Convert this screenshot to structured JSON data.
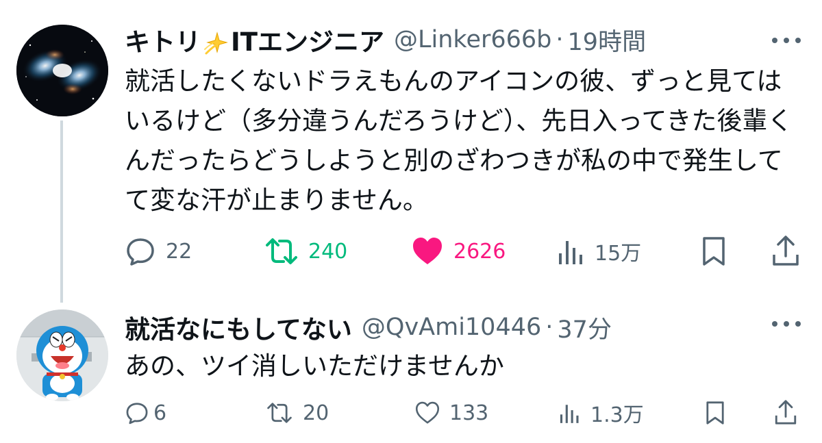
{
  "tweets": [
    {
      "display_name_prefix": "キトリ",
      "display_name_suffix": "ITエンジニア",
      "handle": "@Linker666b",
      "separator": "·",
      "time": "19時間",
      "text": "就活したくないドラえもんのアイコンの彼、ずっと見てはいるけど（多分違うんだろうけど）、先日入ってきた後輩くんだったらどうしようと別のざわつきが私の中で発生してて変な汗が止まりません。",
      "actions": {
        "replies": "22",
        "retweets": "240",
        "likes": "2626",
        "views": "15万"
      },
      "retweet_active": true,
      "like_active": true
    },
    {
      "display_name": "就活なにもしてない",
      "handle": "@QvAmi10446",
      "separator": "·",
      "time": "37分",
      "text": "あの、ツイ消しいただけませんか",
      "actions": {
        "replies": "6",
        "retweets": "20",
        "likes": "133",
        "views": "1.3万"
      },
      "retweet_active": false,
      "like_active": false
    }
  ],
  "colors": {
    "text": "#0f1419",
    "secondary": "#536471",
    "retweet_green": "#00ba7c",
    "like_pink": "#f91880",
    "thread_line": "#cfd9de"
  },
  "icons": [
    "sparkle-icon",
    "more-icon",
    "reply-icon",
    "retweet-icon",
    "like-icon",
    "views-icon",
    "bookmark-icon",
    "share-icon"
  ]
}
